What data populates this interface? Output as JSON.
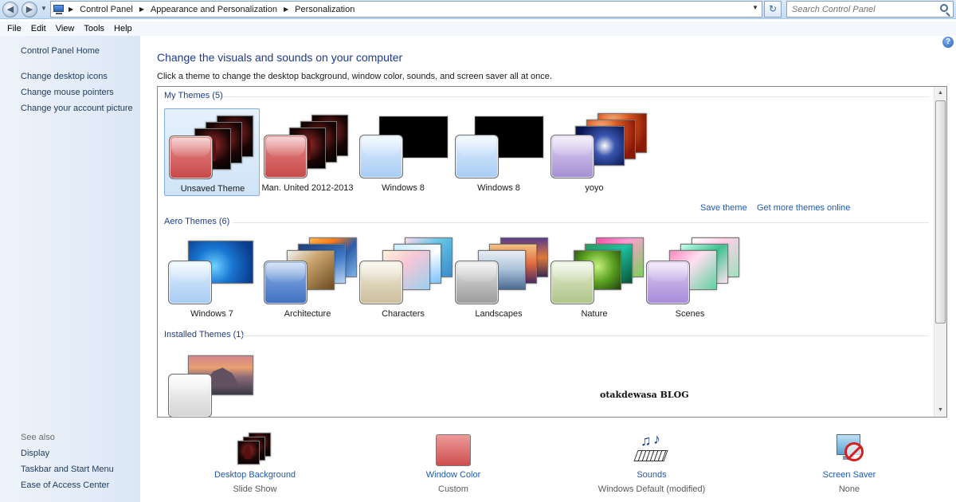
{
  "address": {
    "crumbs": [
      "Control Panel",
      "Appearance and Personalization",
      "Personalization"
    ],
    "search_placeholder": "Search Control Panel"
  },
  "menu": [
    "File",
    "Edit",
    "View",
    "Tools",
    "Help"
  ],
  "sidebar": {
    "home": "Control Panel Home",
    "links": [
      "Change desktop icons",
      "Change mouse pointers",
      "Change your account picture"
    ],
    "see_also_heading": "See also",
    "see_also": [
      "Display",
      "Taskbar and Start Menu",
      "Ease of Access Center"
    ]
  },
  "main": {
    "title": "Change the visuals and sounds on your computer",
    "description": "Click a theme to change the desktop background, window color, sounds, and screen saver all at once."
  },
  "groups": {
    "my_themes": "My Themes (5)",
    "aero_themes": "Aero Themes (6)",
    "installed_themes": "Installed Themes (1)"
  },
  "my_themes": [
    {
      "label": "Unsaved Theme",
      "selected": true,
      "swatch": "#c74848"
    },
    {
      "label": "Man. United 2012-2013",
      "selected": false,
      "swatch": "#c74848"
    },
    {
      "label": "Windows 8",
      "selected": false,
      "swatch": "#a8ccf2"
    },
    {
      "label": "Windows 8",
      "selected": false,
      "swatch": "#a8ccf2"
    },
    {
      "label": "yoyo",
      "selected": false,
      "swatch": "#a48ed2"
    }
  ],
  "aero_themes": [
    {
      "label": "Windows 7",
      "swatch": "#a8ccf2"
    },
    {
      "label": "Architecture",
      "swatch": "#3f6fbf"
    },
    {
      "label": "Characters",
      "swatch": "#cbbf9c"
    },
    {
      "label": "Landscapes",
      "swatch": "#9c9c9c"
    },
    {
      "label": "Nature",
      "swatch": "#b0c48a"
    },
    {
      "label": "Scenes",
      "swatch": "#a88bd8"
    }
  ],
  "theme_links": {
    "save": "Save theme",
    "more": "Get more themes online"
  },
  "watermark": "otakdewasa BLOG",
  "bottom": [
    {
      "label": "Desktop Background",
      "value": "Slide Show",
      "icon": "slideshow-icon"
    },
    {
      "label": "Window Color",
      "value": "Custom",
      "icon": "window-color-swatch"
    },
    {
      "label": "Sounds",
      "value": "Windows Default (modified)",
      "icon": "music-notes-icon"
    },
    {
      "label": "Screen Saver",
      "value": "None",
      "icon": "screen-saver-icon"
    }
  ]
}
